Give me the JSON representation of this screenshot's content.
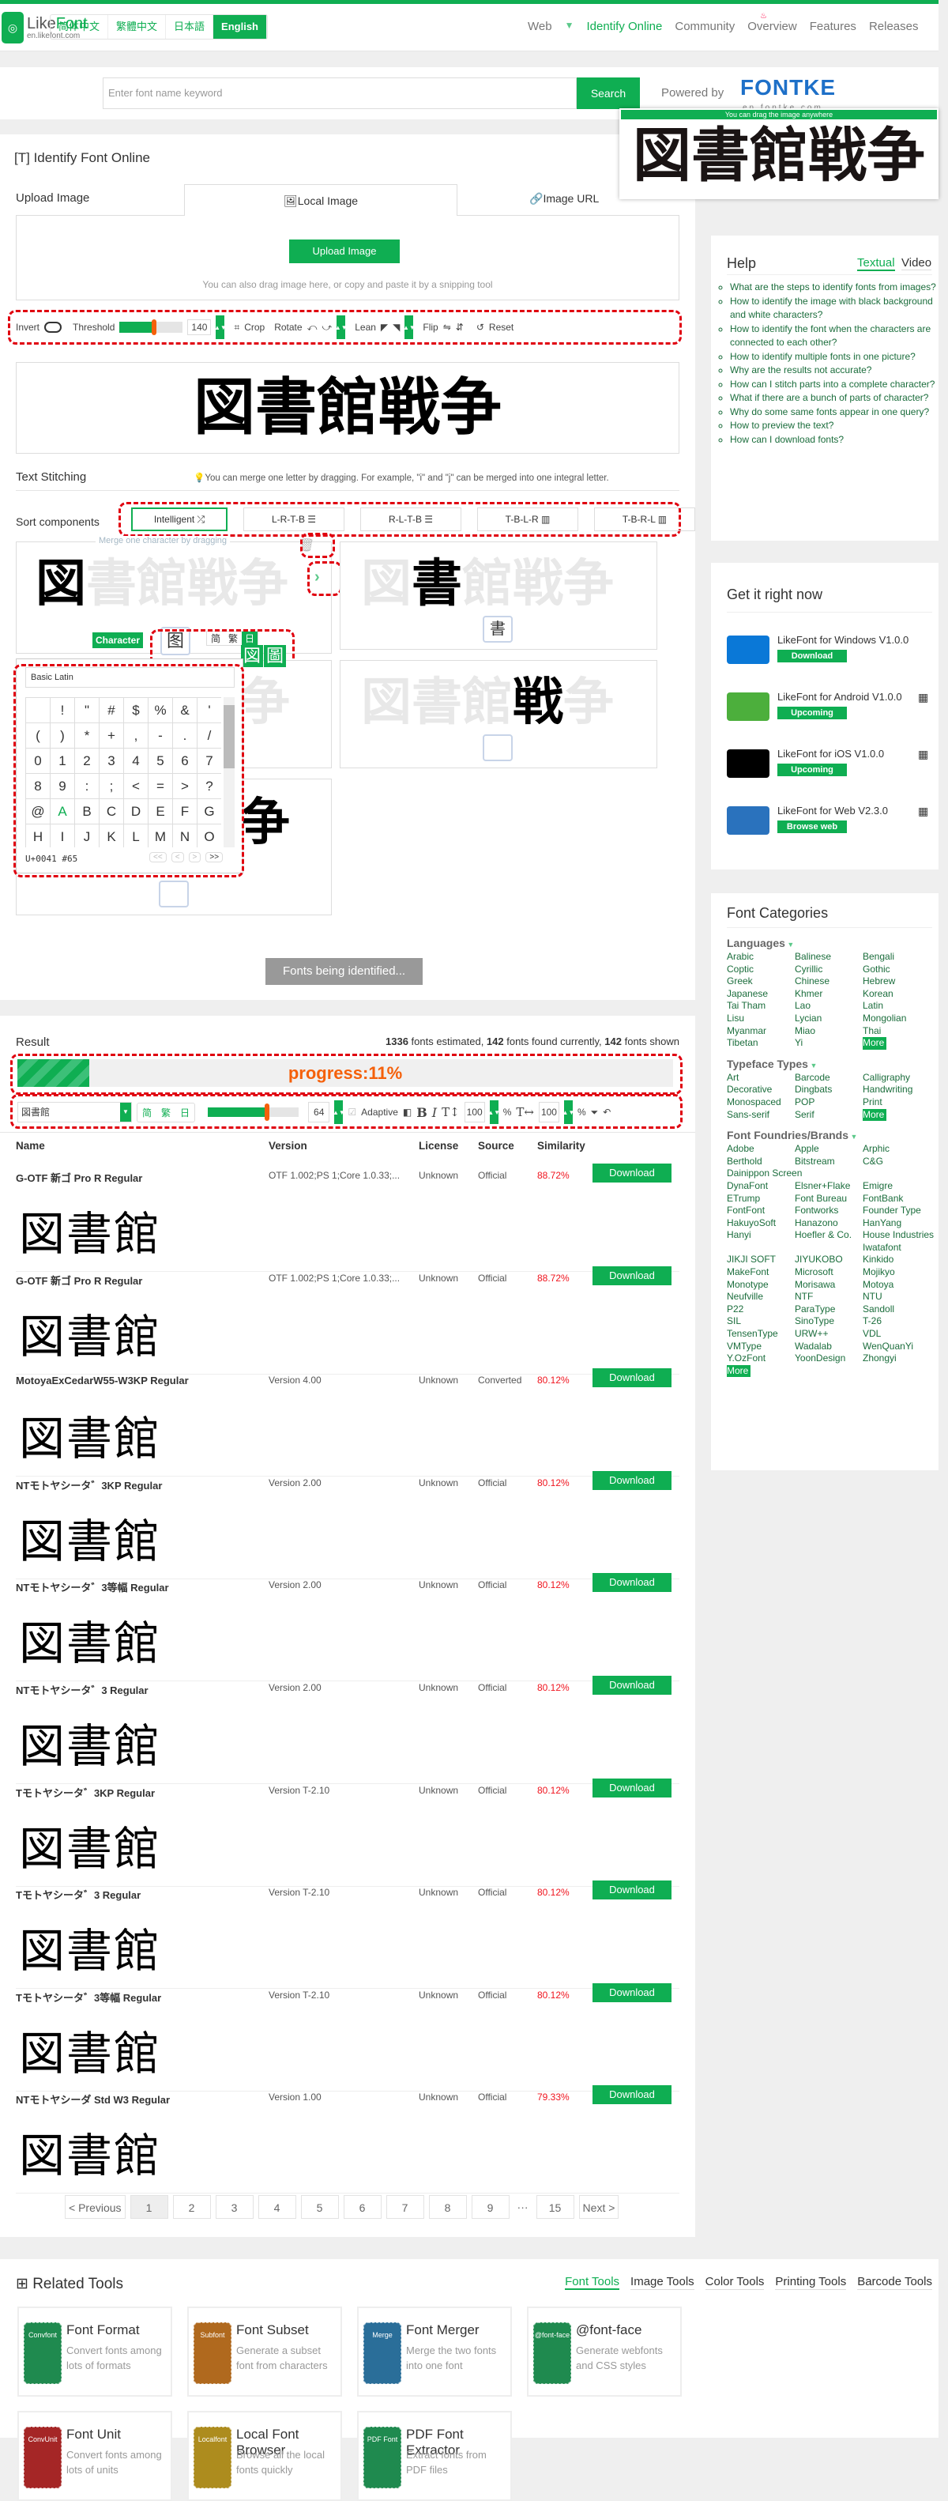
{
  "header": {
    "logo_text_1": "Like",
    "logo_text_2": "Font",
    "logo_sub": "en.likefont.com",
    "langs": [
      "简体中文",
      "繁體中文",
      "日本語",
      "English"
    ],
    "active_lang": "English",
    "nav": [
      "Web",
      "▼",
      "Identify Online",
      "Community",
      "Overview",
      "Features",
      "Releases"
    ],
    "active_nav": "Identify Online"
  },
  "search": {
    "placeholder": "Enter font name keyword",
    "button": "Search",
    "powered_by": "Powered by",
    "brand": "FONTKE",
    "brand_sub": "en.fontke.com"
  },
  "drag_hint": {
    "label": "You can drag the image anywhere",
    "image_text": "図書館戦争"
  },
  "identify": {
    "title": "Identify Font Online",
    "upload_label": "Upload Image",
    "tabs": [
      "Local Image",
      "Image URL"
    ],
    "active_tab": "Local Image",
    "upload_button": "Upload Image",
    "upload_hint": "You can also drag image here, or copy and paste it by a snipping tool",
    "toolbar": {
      "invert": "Invert",
      "threshold": "Threshold",
      "threshold_value": "140",
      "threshold_fraction": 0.55,
      "crop": "Crop",
      "rotate": "Rotate",
      "lean": "Lean",
      "flip": "Flip",
      "reset": "Reset"
    },
    "preview_text": "図書館戦争",
    "stitch_title": "Text Stitching",
    "stitch_tip": "You can merge one letter by dragging. For example, \"i\" and \"j\" can be merged into one integral letter.",
    "sort_label": "Sort components",
    "sort_options": [
      "Intelligent",
      "L-R-T-B",
      "R-L-T-B",
      "T-B-L-R",
      "T-B-R-L"
    ],
    "sort_active": "Intelligent",
    "merge_hint": "Merge one character by dragging",
    "components": [
      {
        "char": "図",
        "candidate": "图"
      },
      {
        "char": "書",
        "candidate": "書"
      },
      {
        "char": "館",
        "candidate": ""
      },
      {
        "char": "戦",
        "candidate": ""
      },
      {
        "char": "争",
        "candidate": ""
      }
    ],
    "character_badge": "Character",
    "script_buttons": [
      "简",
      "繁",
      "日"
    ],
    "active_script": "日",
    "alt_glyphs": [
      "図",
      "圖"
    ],
    "picker": {
      "block": "Basic Latin",
      "chars": [
        "",
        " !",
        "\"",
        "#",
        "$",
        "%",
        "&",
        "'",
        "(",
        ")",
        "*",
        "+",
        ",",
        "-",
        ".",
        "/",
        "0",
        "1",
        "2",
        "3",
        "4",
        "5",
        "6",
        "7",
        "8",
        "9",
        ":",
        ";",
        "<",
        "=",
        ">",
        "?",
        "@",
        "A",
        "B",
        "C",
        "D",
        "E",
        "F",
        "G",
        "H",
        "I",
        "J",
        "K",
        "L",
        "M",
        "N",
        "O"
      ],
      "selected": "A",
      "code": "U+0041",
      "dec": "#65",
      "nav": [
        "<<",
        "<",
        ">",
        ">>"
      ]
    },
    "status": "Fonts being identified..."
  },
  "result": {
    "title": "Result",
    "stats": {
      "estimated": "1336",
      "estimated_label": " fonts estimated, ",
      "found": "142",
      "found_label": " fonts found currently, ",
      "shown": "142",
      "shown_label": " fonts shown"
    },
    "progress_label": "progress:11%",
    "progress": 0.11,
    "preview_text": "図書館",
    "scripts": [
      "简",
      "繁",
      "日"
    ],
    "size": "64",
    "size_fraction": 0.65,
    "adaptive": "Adaptive",
    "line_height": "100",
    "letter_spacing": "100",
    "percent": "%",
    "columns": [
      "Name",
      "Version",
      "License",
      "Source",
      "Similarity"
    ],
    "download": "Download",
    "rows": [
      {
        "name": "G-OTF 新ゴ Pro R Regular",
        "version": "OTF 1.002;PS 1;Core 1.0.33;...",
        "license": "Unknown",
        "source": "Official",
        "similarity": "88.72%"
      },
      {
        "name": "G-OTF 新ゴ Pro R Regular",
        "version": "OTF 1.002;PS 1;Core 1.0.33;...",
        "license": "Unknown",
        "source": "Official",
        "similarity": "88.72%"
      },
      {
        "name": "MotoyaExCedarW55-W3KP Regular",
        "version": "Version 4.00",
        "license": "Unknown",
        "source": "Converted",
        "similarity": "80.12%"
      },
      {
        "name": "NTモトヤシータ゛3KP Regular",
        "version": "Version 2.00",
        "license": "Unknown",
        "source": "Official",
        "similarity": "80.12%"
      },
      {
        "name": "NTモトヤシータ゛3等幅 Regular",
        "version": "Version 2.00",
        "license": "Unknown",
        "source": "Official",
        "similarity": "80.12%"
      },
      {
        "name": "NTモトヤシータ゛3 Regular",
        "version": "Version 2.00",
        "license": "Unknown",
        "source": "Official",
        "similarity": "80.12%"
      },
      {
        "name": "Tモトヤシータ゛3KP Regular",
        "version": "Version T-2.10",
        "license": "Unknown",
        "source": "Official",
        "similarity": "80.12%"
      },
      {
        "name": "Tモトヤシータ゛3 Regular",
        "version": "Version T-2.10",
        "license": "Unknown",
        "source": "Official",
        "similarity": "80.12%"
      },
      {
        "name": "Tモトヤシータ゛3等幅 Regular",
        "version": "Version T-2.10",
        "license": "Unknown",
        "source": "Official",
        "similarity": "80.12%"
      },
      {
        "name": "NTモトヤシーダ Std W3 Regular",
        "version": "Version 1.00",
        "license": "Unknown",
        "source": "Official",
        "similarity": "79.33%"
      }
    ],
    "pagination": [
      "< Previous",
      "1",
      "2",
      "3",
      "4",
      "5",
      "6",
      "7",
      "8",
      "9",
      "···",
      "15",
      "Next >"
    ],
    "current_page": "1"
  },
  "help": {
    "title": "Help",
    "tabs": [
      "Textual",
      "Video"
    ],
    "active_tab": "Textual",
    "items": [
      "What are the steps to identify fonts from images?",
      "How to identify the image with black background and white characters?",
      "How to identify the font when the characters are connected to each other?",
      "How to identify multiple fonts in one picture?",
      "Why are the results not accurate?",
      "How can I stitch parts into a complete character?",
      "What if there are a bunch of parts of character?",
      "Why do some same fonts appear in one query?",
      "How to preview the text?",
      "How can I download fonts?"
    ]
  },
  "apps": {
    "title": "Get it right now",
    "items": [
      {
        "name": "LikeFont for Windows V1.0.0",
        "button": "Download",
        "color": "#0a78d7"
      },
      {
        "name": "LikeFont for Android V1.0.0",
        "button": "Upcoming",
        "color": "#4caf3c"
      },
      {
        "name": "LikeFont for iOS V1.0.0",
        "button": "Upcoming",
        "color": "#000000"
      },
      {
        "name": "LikeFont for Web V2.3.0",
        "button": "Browse web",
        "color": "#2a72bd"
      }
    ]
  },
  "categories": {
    "title": "Font Categories",
    "more": "More",
    "groups": [
      {
        "title": "Languages",
        "items": [
          "Arabic",
          "Balinese",
          "Bengali",
          "Coptic",
          "Cyrillic",
          "Gothic",
          "Greek",
          "Chinese",
          "Hebrew",
          "Japanese",
          "Khmer",
          "Korean",
          "Tai Tham",
          "Lao",
          "Latin",
          "Lisu",
          "Lycian",
          "Mongolian",
          "Myanmar",
          "Miao",
          "Thai",
          "Tibetan",
          "Yi"
        ]
      },
      {
        "title": "Typeface Types",
        "items": [
          "Art",
          "Barcode",
          "Calligraphy",
          "Decorative",
          "Dingbats",
          "Handwriting",
          "Monospaced",
          "POP",
          "Print",
          "Sans-serif",
          "Serif"
        ]
      },
      {
        "title": "Font Foundries/Brands",
        "items": [
          "Adobe",
          "Apple",
          "Arphic",
          "Berthold",
          "Bitstream",
          "C&G",
          "Dainippon Screen",
          "",
          "",
          "DynaFont",
          "Elsner+Flake",
          "Emigre",
          "ETrump",
          "Font Bureau",
          "FontBank",
          "FontFont",
          "Fontworks",
          "Founder Type",
          "HakuyoSoft",
          "Hanazono",
          "HanYang",
          "Hanyi",
          "Hoefler & Co.",
          "House Industries",
          "",
          "",
          "Iwatafont",
          "JIKJI SOFT",
          "JIYUKOBO",
          "Kinkido",
          "MakeFont",
          "Microsoft",
          "Mojikyo",
          "Monotype",
          "Morisawa",
          "Motoya",
          "Neufville",
          "NTF",
          "NTU",
          "P22",
          "ParaType",
          "Sandoll",
          "SIL",
          "SinoType",
          "T-26",
          "TensenType",
          "URW++",
          "VDL",
          "VMType",
          "Wadalab",
          "WenQuanYi",
          "Y.OzFont",
          "YoonDesign",
          "Zhongyi"
        ]
      }
    ]
  },
  "related": {
    "title": "Related Tools",
    "tabs": [
      "Font Tools",
      "Image Tools",
      "Color Tools",
      "Printing Tools",
      "Barcode Tools"
    ],
    "active_tab": "Font Tools",
    "tools": [
      {
        "title": "Font Format",
        "desc": "Convert fonts among lots of formats",
        "badge": "Convfont",
        "color": "#1f8a4f"
      },
      {
        "title": "Font Subset",
        "desc": "Generate a subset font from characters",
        "badge": "Subfont",
        "color": "#b0691e"
      },
      {
        "title": "Font Merger",
        "desc": "Merge the two fonts into one font",
        "badge": "Merge",
        "color": "#2a6e99"
      },
      {
        "title": "@font-face",
        "desc": "Generate webfonts and CSS styles",
        "badge": "@font-face",
        "color": "#1f8a4f"
      },
      {
        "title": "Font Unit",
        "desc": "Convert fonts among lots of units",
        "badge": "ConvUnit",
        "color": "#a52626"
      },
      {
        "title": "Local Font Browser",
        "desc": "Browse all the local fonts quickly",
        "badge": "Localfont",
        "color": "#ad8c1e"
      },
      {
        "title": "PDF Font Extractor",
        "desc": "Extract fonts from PDF files",
        "badge": "PDF Font",
        "color": "#1f8a4f"
      }
    ]
  }
}
